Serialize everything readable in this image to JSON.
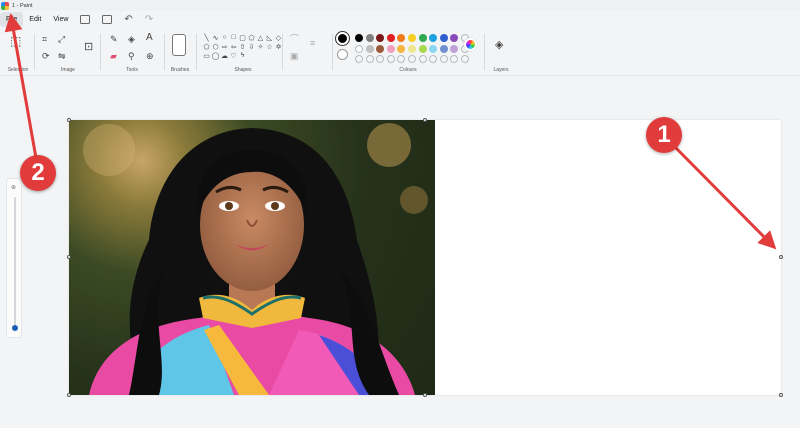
{
  "window": {
    "title": "1 - Paint"
  },
  "menu": {
    "items": [
      {
        "label": "File",
        "active": true
      },
      {
        "label": "Edit",
        "active": false
      },
      {
        "label": "View",
        "active": false
      }
    ]
  },
  "ribbon": {
    "groups": {
      "selection": "Selection",
      "image": "Image",
      "tools": "Tools",
      "brushes": "Brushes",
      "shapes": "Shapes",
      "colours": "Colours",
      "layers": "Layers"
    }
  },
  "colors": {
    "primary": "#000000",
    "secondary": "#ffffff",
    "palette_row1": [
      "#000000",
      "#808080",
      "#7a1717",
      "#e02020",
      "#f07a1a",
      "#f5d020",
      "#2fa84f",
      "#1fa3e0",
      "#2f5fd0",
      "#8a4ab8"
    ],
    "palette_row2": [
      "#ffffff",
      "#c0c0c0",
      "#9c5a3c",
      "#f2a0c0",
      "#f5b540",
      "#f0e68c",
      "#a8d850",
      "#8ad8f0",
      "#7090d0",
      "#c0a0d8"
    ]
  },
  "annotations": {
    "badge1": "1",
    "badge2": "2",
    "accent": "#e23b3b"
  }
}
